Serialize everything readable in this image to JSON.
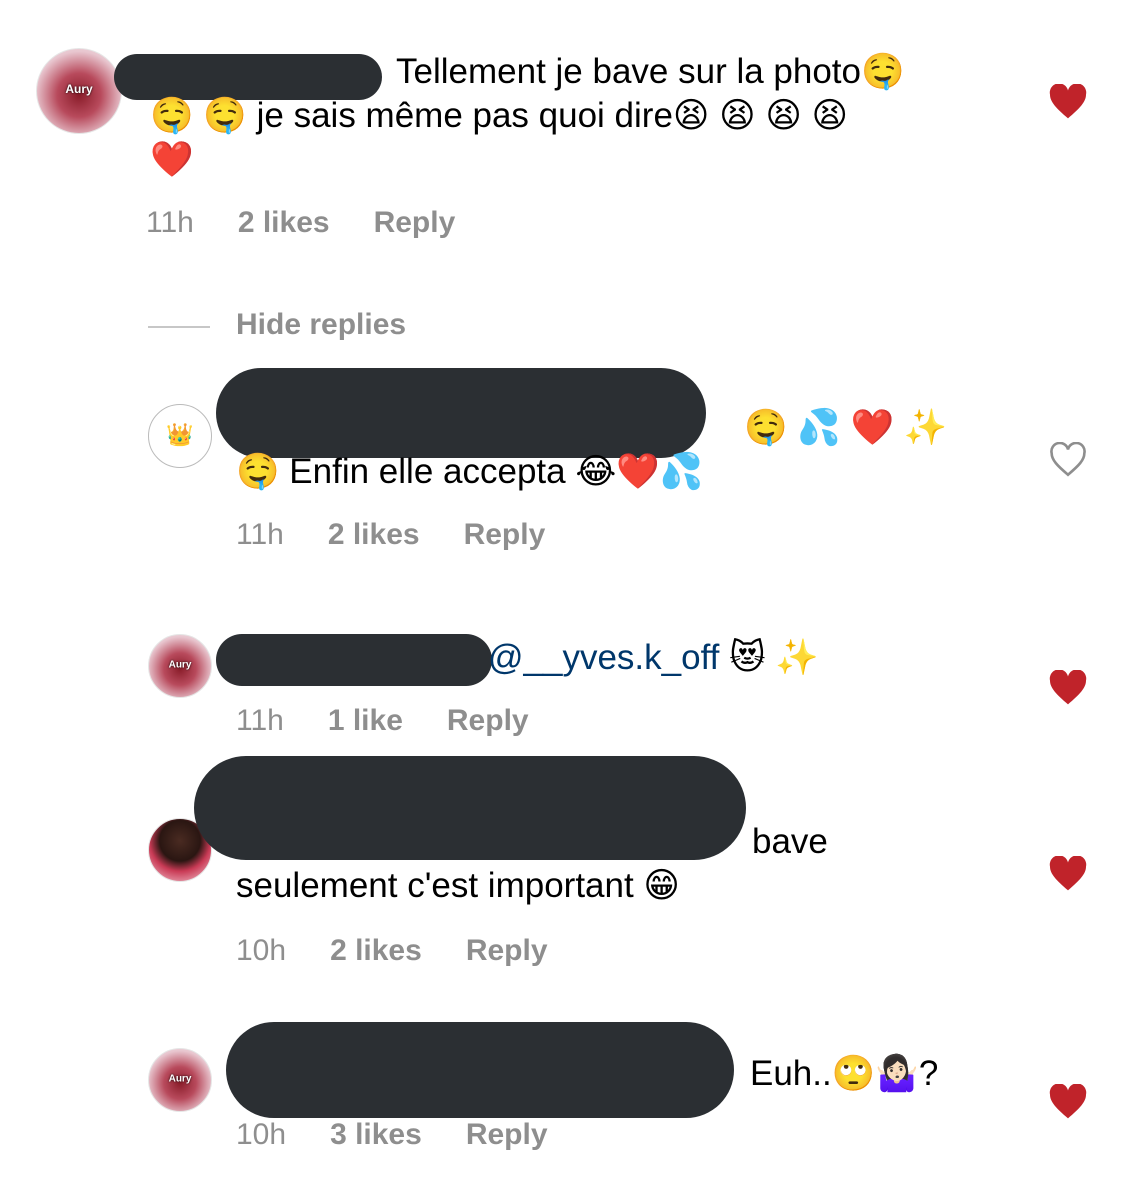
{
  "comments": [
    {
      "avatar_label": "Aury",
      "text_line1": "Tellement je bave sur la photo🤤",
      "text_line2": "🤤 🤤 je sais même pas quoi dire😫 😫 😫 😫",
      "text_line3": "❤️",
      "time": "11h",
      "likes": "2 likes",
      "reply": "Reply",
      "liked": true
    },
    {
      "avatar_label": "👑",
      "text_line1": "🤤 💦 ❤️ ✨",
      "text_line2": "🤤  Enfin elle accepta 😂❤️💦",
      "time": "11h",
      "likes": "2 likes",
      "reply": "Reply",
      "liked": false
    },
    {
      "avatar_label": "Aury",
      "mention": "@__yves.k_off",
      "text_line1": " 😻 ✨",
      "time": "11h",
      "likes": "1 like",
      "reply": "Reply",
      "liked": true
    },
    {
      "avatar_label": "",
      "text_line1": "bave",
      "text_line2": "seulement c'est important 😁",
      "time": "10h",
      "likes": "2 likes",
      "reply": "Reply",
      "liked": true
    },
    {
      "avatar_label": "Aury",
      "text_line1": "Euh..🙄🤷🏻‍♀️?",
      "time": "10h",
      "likes": "3 likes",
      "reply": "Reply",
      "liked": true
    }
  ],
  "hide_replies": "Hide replies",
  "colors": {
    "heart_filled": "#c0232a",
    "heart_outline": "#8e8e8e",
    "meta": "#8e8e8e",
    "mention": "#00376b"
  }
}
